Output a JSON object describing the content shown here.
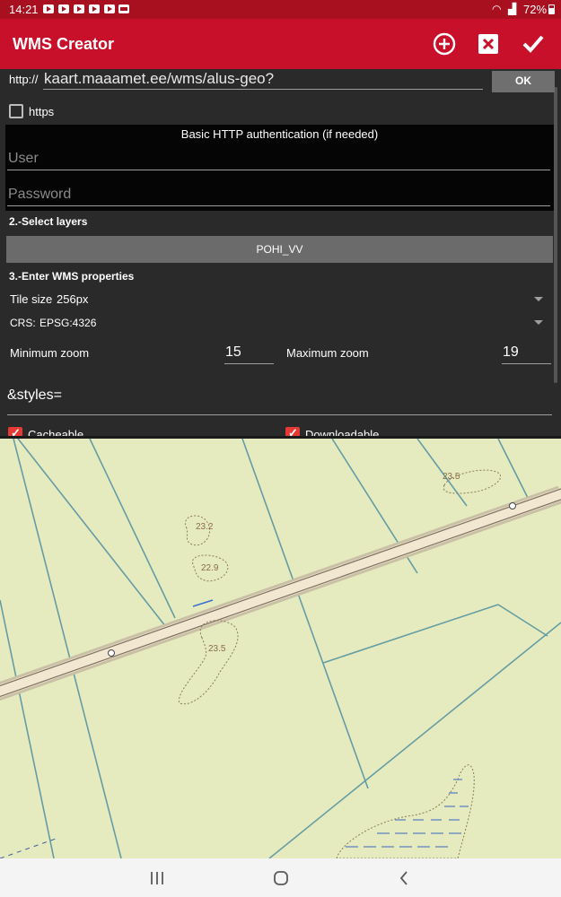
{
  "status_bar": {
    "time": "14:21",
    "battery": "72%"
  },
  "app": {
    "title": "WMS Creator"
  },
  "url": {
    "prefix": "http://",
    "value": "kaart.maaamet.ee/wms/alus-geo?",
    "ok_label": "OK"
  },
  "https": {
    "label": "https",
    "checked": false
  },
  "auth": {
    "heading": "Basic HTTP authentication (if needed)",
    "user_placeholder": "User",
    "password_placeholder": "Password"
  },
  "layers": {
    "section": "2.-Select layers",
    "selected": "POHI_VV"
  },
  "props": {
    "section": "3.-Enter WMS properties",
    "tile_size_label": "Tile size",
    "tile_size_value": "256px",
    "crs_label": "CRS:",
    "crs_value": "EPSG:4326",
    "min_zoom_label": "Minimum zoom",
    "min_zoom_value": "15",
    "max_zoom_label": "Maximum zoom",
    "max_zoom_value": "19",
    "styles_value": "&styles=",
    "cacheable_label": "Cacheable",
    "downloadable_label": "Downloadable"
  },
  "map": {
    "labels": [
      "23.5",
      "23.2",
      "22.9",
      "23.5"
    ]
  }
}
